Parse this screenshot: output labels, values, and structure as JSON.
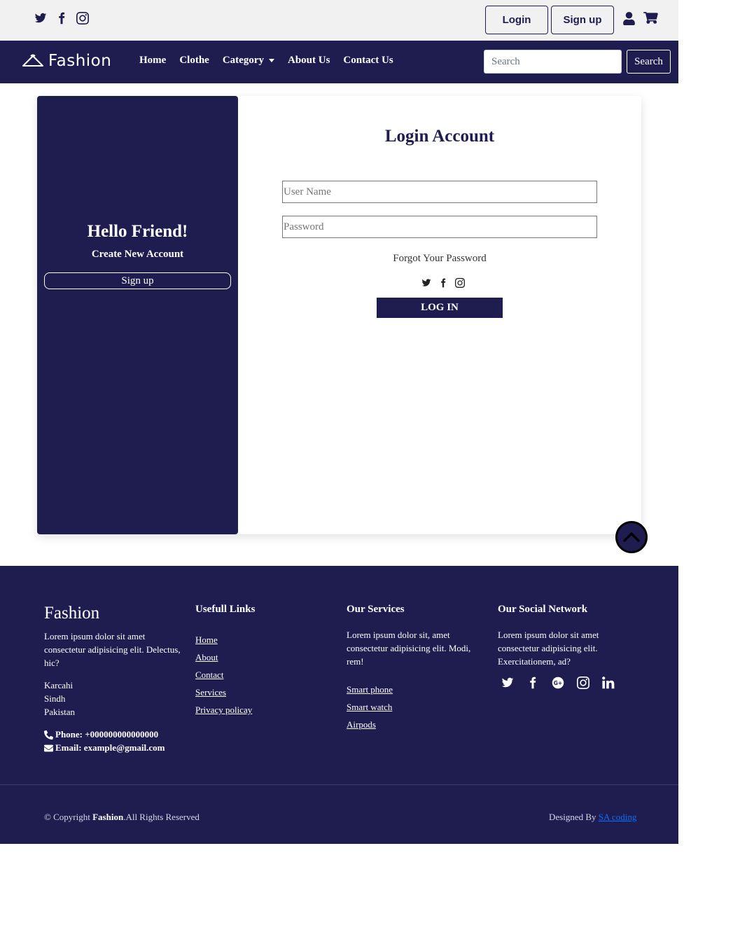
{
  "topbar": {
    "social_icons": [
      "twitter-icon",
      "facebook-icon",
      "instagram-icon"
    ],
    "login_label": "Login",
    "signup_label": "Sign up",
    "icons": [
      "user-icon",
      "cart-icon"
    ]
  },
  "navbar": {
    "brand": "Fashion",
    "links": [
      "Home",
      "Clothe",
      "Category",
      "About Us",
      "Contact Us"
    ],
    "search_placeholder": "Search",
    "search_button": "Search"
  },
  "left_panel": {
    "heading": "Hello Friend!",
    "subheading": "Create New Account",
    "signup_label": "Sign up"
  },
  "login_form": {
    "title": "Login Account",
    "username_placeholder": "User Name",
    "password_placeholder": "Password",
    "forgot": "Forgot Your Password",
    "social_icons": [
      "twitter-icon",
      "facebook-icon",
      "instagram-icon"
    ],
    "submit_label": "LOG IN"
  },
  "footer": {
    "brand": "Fashion",
    "about": "Lorem ipsum dolor sit amet consectetur adipisicing elit. Delectus, hic?",
    "address": [
      "Karcahi",
      "Sindh",
      "Pakistan"
    ],
    "phone": "Phone: +000000000000000",
    "email": "Email: example@gmail.com",
    "useful_links_title": "Usefull Links",
    "useful_links": [
      "Home",
      "About",
      "Contact",
      "Services",
      "Privacy policay"
    ],
    "services_title": "Our Services",
    "services_text": "Lorem ipsum dolor sit, amet consectetur adipisicing elit. Modi, rem!",
    "services": [
      "Smart phone",
      "Smart watch",
      "Airpods"
    ],
    "social_title": "Our Social Network",
    "social_text": "Lorem ipsum dolor sit amet consectetur adipisicing elit. Exercitationem, ad?",
    "social_icons": [
      "twitter-icon",
      "facebook-icon",
      "google-plus-icon",
      "instagram-icon",
      "linkedin-icon"
    ],
    "copyright_prefix": "© Copyright ",
    "copyright_brand": "Fashion",
    "copyright_suffix": ".All Rights Reserved",
    "designed_by": "Designed By ",
    "designer": "SA coding"
  },
  "colors": {
    "primary": "#1f1d50",
    "topbar_bg": "#f1f1f1",
    "link": "#0d6efd"
  }
}
